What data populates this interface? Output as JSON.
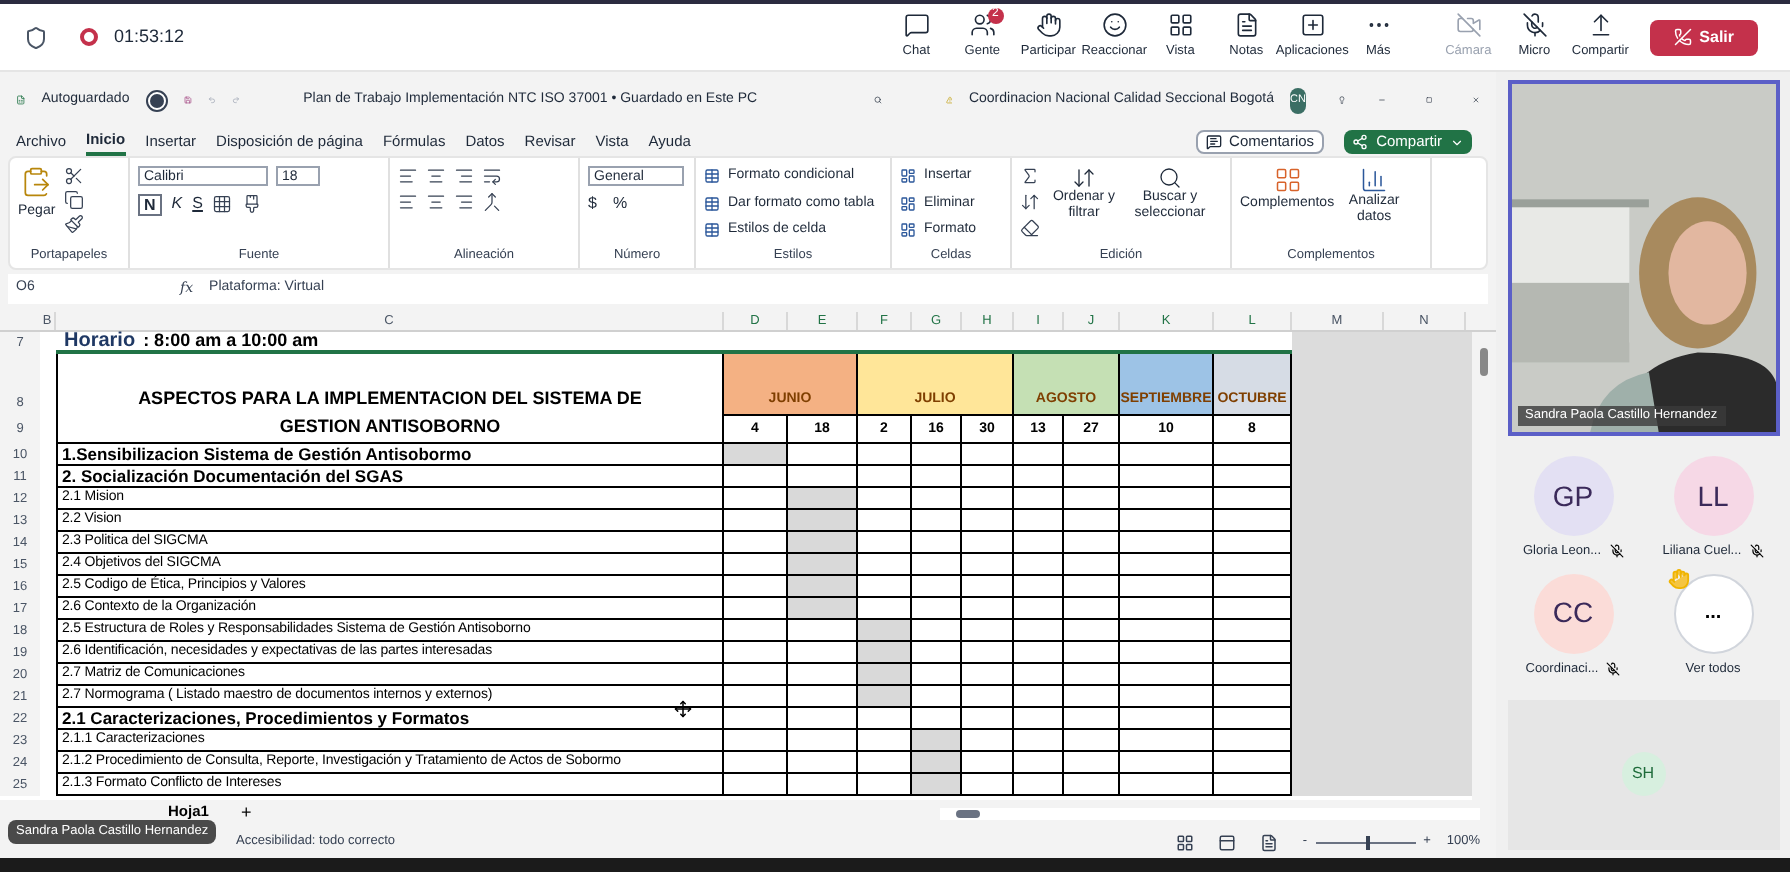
{
  "meeting": {
    "timer": "01:53:12",
    "toolbar": [
      {
        "label": "Chat",
        "disabled": false
      },
      {
        "label": "Gente",
        "badge": "2",
        "disabled": false
      },
      {
        "label": "Participar",
        "disabled": false
      },
      {
        "label": "Reaccionar",
        "disabled": false
      },
      {
        "label": "Vista",
        "disabled": false
      },
      {
        "label": "Notas",
        "disabled": false
      },
      {
        "label": "Aplicaciones",
        "disabled": false
      },
      {
        "label": "Más",
        "disabled": false
      },
      {
        "label": "Cámara",
        "disabled": true
      },
      {
        "label": "Micro",
        "disabled": false
      },
      {
        "label": "Compartir",
        "disabled": false
      }
    ],
    "leave": "Salir"
  },
  "excel": {
    "autosave": {
      "label": "Autoguardado",
      "on": false
    },
    "title": "Plan de Trabajo Implementación NTC ISO 37001 • Guardado en Este PC",
    "account": "Coordinacion Nacional Calidad Seccional Bogotá",
    "avatar": "CN",
    "tabs": [
      {
        "label": "Archivo",
        "selected": false
      },
      {
        "label": "Inicio",
        "selected": true
      },
      {
        "label": "Insertar",
        "selected": false
      },
      {
        "label": "Disposición de página",
        "selected": false
      },
      {
        "label": "Fórmulas",
        "selected": false
      },
      {
        "label": "Datos",
        "selected": false
      },
      {
        "label": "Revisar",
        "selected": false
      },
      {
        "label": "Vista",
        "selected": false
      },
      {
        "label": "Ayuda",
        "selected": false
      }
    ],
    "comments": "Comentarios",
    "share": "Compartir",
    "ribbon": {
      "paste": "Pegar",
      "font": "Calibri",
      "size": "18",
      "bold": "N",
      "italic": "K",
      "underline": "S",
      "number_format": "General",
      "currency": "$",
      "percent": "%",
      "styles": [
        "Formato condicional",
        "Dar formato como tabla",
        "Estilos de celda"
      ],
      "cells": [
        "Insertar",
        "Eliminar",
        "Formato"
      ],
      "sort": "Ordenar y filtrar",
      "find": "Buscar y seleccionar",
      "addins": "Complementos",
      "analyze": "Analizar datos",
      "groups": [
        "Portapapeles",
        "Fuente",
        "Alineación",
        "Número",
        "Estilos",
        "Celdas",
        "Edición",
        "Complementos"
      ]
    },
    "name_box": "O6",
    "fx": "fx",
    "formula": "Plataforma: Virtual",
    "columns": [
      "B",
      "C",
      "D",
      "E",
      "F",
      "G",
      "H",
      "I",
      "J",
      "K",
      "L",
      "M",
      "N"
    ],
    "schedule_label": "Horario",
    "schedule_value": ": 8:00 am a 10:00 am",
    "header_rows": [
      "7",
      "8",
      "9"
    ],
    "heading": "ASPECTOS PARA LA IMPLEMENTACION DEL SISTEMA DE GESTION ANTISOBORNO",
    "months": [
      {
        "label": "JUNIO",
        "color": "#f4b183"
      },
      {
        "label": "JULIO",
        "color": "#ffe699"
      },
      {
        "label": "AGOSTO",
        "color": "#c5e0b4"
      },
      {
        "label": "SEPTIEMBRE",
        "color": "#9dc3e6"
      },
      {
        "label": "OCTUBRE",
        "color": "#d6dce5"
      }
    ],
    "days": [
      "4",
      "18",
      "2",
      "16",
      "30",
      "13",
      "27",
      "10",
      "8"
    ],
    "rows": [
      {
        "num": "10",
        "text": "1.Sensibilizacion Sistema de Gestión Antisobormo",
        "kind": "section",
        "shaded": [
          true,
          false,
          false,
          false,
          false,
          false,
          false,
          false,
          false
        ]
      },
      {
        "num": "11",
        "text": "2. Socialización Documentación del SGAS",
        "kind": "section",
        "shaded": [
          false,
          false,
          false,
          false,
          false,
          false,
          false,
          false,
          false
        ]
      },
      {
        "num": "12",
        "text": "2.1 Mision",
        "kind": "item",
        "shaded": [
          false,
          true,
          false,
          false,
          false,
          false,
          false,
          false,
          false
        ]
      },
      {
        "num": "13",
        "text": "2.2 Vision",
        "kind": "item",
        "shaded": [
          false,
          true,
          false,
          false,
          false,
          false,
          false,
          false,
          false
        ]
      },
      {
        "num": "14",
        "text": "2.3 Politica del SIGCMA",
        "kind": "item",
        "shaded": [
          false,
          true,
          false,
          false,
          false,
          false,
          false,
          false,
          false
        ]
      },
      {
        "num": "15",
        "text": "2.4 Objetivos del SIGCMA",
        "kind": "item",
        "shaded": [
          false,
          true,
          false,
          false,
          false,
          false,
          false,
          false,
          false
        ]
      },
      {
        "num": "16",
        "text": "2.5 Codigo de Ética, Principios y Valores",
        "kind": "item",
        "shaded": [
          false,
          true,
          false,
          false,
          false,
          false,
          false,
          false,
          false
        ]
      },
      {
        "num": "17",
        "text": "2.6 Contexto de la Organización",
        "kind": "item",
        "shaded": [
          false,
          true,
          false,
          false,
          false,
          false,
          false,
          false,
          false
        ]
      },
      {
        "num": "18",
        "text": "2.5 Estructura de Roles y Responsabilidades Sistema de Gestión Antisoborno",
        "kind": "item",
        "shaded": [
          false,
          false,
          true,
          false,
          false,
          false,
          false,
          false,
          false
        ]
      },
      {
        "num": "19",
        "text": "2.6 Identificación, necesidades y expectativas de las partes interesadas",
        "kind": "item",
        "shaded": [
          false,
          false,
          true,
          false,
          false,
          false,
          false,
          false,
          false
        ]
      },
      {
        "num": "20",
        "text": "2.7 Matriz de Comunicaciones",
        "kind": "item",
        "shaded": [
          false,
          false,
          true,
          false,
          false,
          false,
          false,
          false,
          false
        ]
      },
      {
        "num": "21",
        "text": "2.7 Normograma ( Listado maestro de documentos internos y externos)",
        "kind": "item",
        "shaded": [
          false,
          false,
          true,
          false,
          false,
          false,
          false,
          false,
          false
        ]
      },
      {
        "num": "22",
        "text": "2.1 Caracterizaciones, Procedimientos y Formatos",
        "kind": "section",
        "shaded": [
          false,
          false,
          false,
          false,
          false,
          false,
          false,
          false,
          false
        ]
      },
      {
        "num": "23",
        "text": "2.1.1 Caracterizaciones",
        "kind": "item",
        "shaded": [
          false,
          false,
          false,
          true,
          false,
          false,
          false,
          false,
          false
        ]
      },
      {
        "num": "24",
        "text": "2.1.2 Procedimiento de Consulta, Reporte, Investigación y Tratamiento de Actos de Sobormo",
        "kind": "item",
        "shaded": [
          false,
          false,
          false,
          true,
          false,
          false,
          false,
          false,
          false
        ]
      },
      {
        "num": "25",
        "text": "2.1.3 Formato Conflicto de Intereses",
        "kind": "item",
        "shaded": [
          false,
          false,
          false,
          true,
          false,
          false,
          false,
          false,
          false
        ]
      }
    ],
    "sheets": [
      {
        "label": "Hoja1",
        "selected": true
      }
    ],
    "add_sheet": "+",
    "tooltip": "Sandra Paola Castillo Hernandez",
    "accessibility": "Accesibilidad: todo correcto",
    "zoom_out": "-",
    "zoom_in": "+",
    "zoom": "100%",
    "zoom_slider": {
      "level": 0.5
    }
  },
  "participants": {
    "speaker": "Sandra Paola Castillo Hernandez",
    "people": [
      {
        "initials": "GP",
        "name": "Gloria Leon...",
        "muted": true,
        "color": "#e3e0f3"
      },
      {
        "initials": "LL",
        "name": "Liliana Cuel...",
        "muted": true,
        "color": "#f6d8e6"
      },
      {
        "initials": "CC",
        "name": "Coordinaci...",
        "muted": true,
        "color": "#fbdcd8"
      }
    ],
    "more": {
      "label": "Ver todos",
      "icon": "...",
      "hand_raised": true
    },
    "self": {
      "initials": "SH",
      "color": "#d7efdf"
    }
  }
}
